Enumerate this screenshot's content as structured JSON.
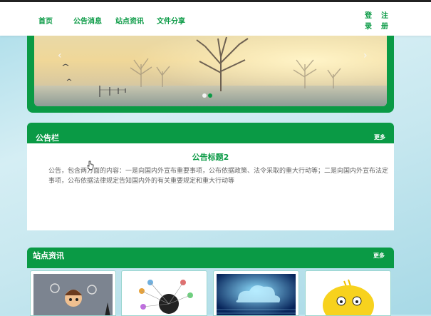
{
  "nav": {
    "home": "首页",
    "notices": "公告消息",
    "news": "站点资讯",
    "files": "文件分享"
  },
  "auth": {
    "login_1": "登",
    "login_2": "录",
    "register_1": "注",
    "register_2": "册"
  },
  "banner": {
    "prev_icon": "chevron-left-icon",
    "next_icon": "chevron-right-icon",
    "dots": 2,
    "active_dot": 2
  },
  "notice_section": {
    "title": "公告栏",
    "more": "更多",
    "item_title": "公告标题2",
    "item_text": "公告，包含两方面的内容：一是向国内外宣布重要事项，公布依据政策、法令采取的重大行动等；二是向国内外宣布法定事项，公布依据法律规定告知国内外的有关重要规定和重大行动等"
  },
  "news_section": {
    "title": "站点资讯",
    "more": "更多"
  },
  "colors": {
    "accent": "#0a9a45",
    "background": "#bfe6ef"
  }
}
